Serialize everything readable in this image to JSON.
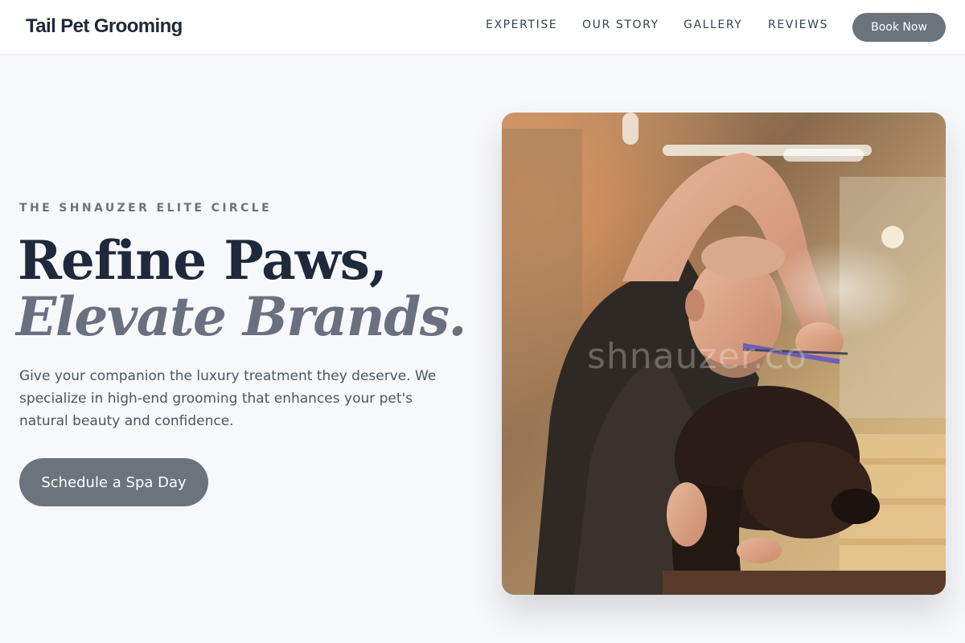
{
  "header": {
    "brand": "Tail Pet Grooming",
    "nav": {
      "expertise": "EXPERTISE",
      "our_story": "OUR STORY",
      "gallery": "GALLERY",
      "reviews": "REVIEWS"
    },
    "book_button": "Book Now"
  },
  "hero": {
    "eyebrow": "THE SHNAUZER ELITE CIRCLE",
    "headline_line1": "Refine Paws,",
    "headline_line2": "Elevate Brands.",
    "description": "Give your companion the luxury treatment they deserve. We specialize in high-end grooming that enhances your pet's natural beauty and confidence.",
    "cta_button": "Schedule a Spa Day",
    "image": {
      "watermark": "shnauzer.co"
    }
  },
  "colors": {
    "page_background": "#f7f8fa",
    "heading_dark": "#1e293b",
    "heading_italic": "#6b7080",
    "button_fill": "#6b747c",
    "body_text": "#4b5563"
  },
  "icons": []
}
